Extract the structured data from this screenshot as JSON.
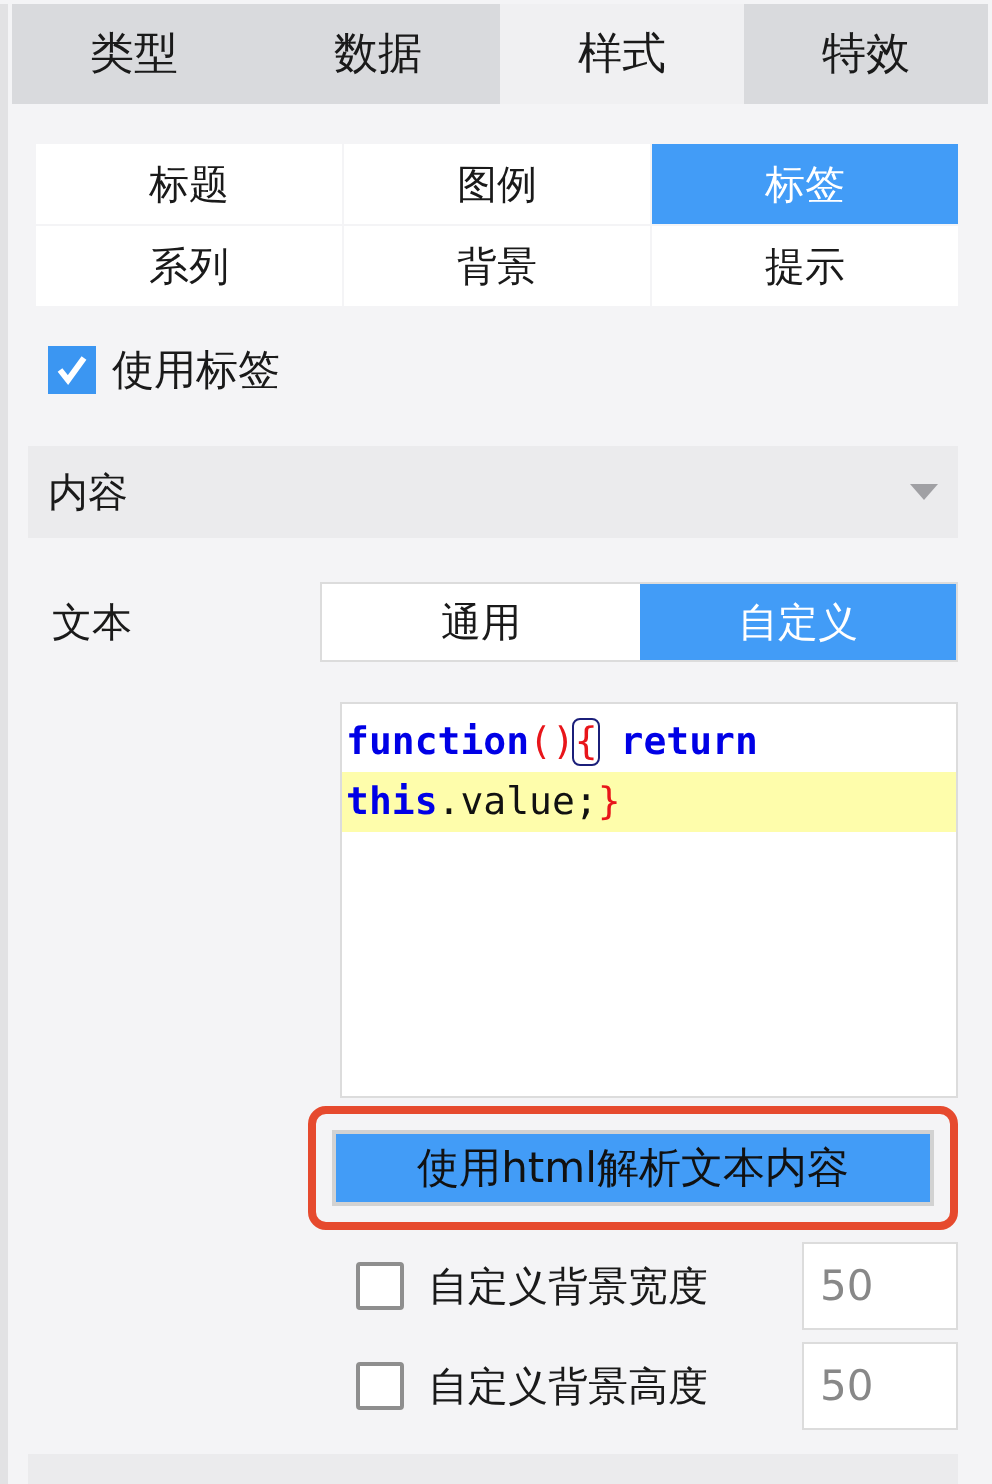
{
  "main_tabs": [
    {
      "label": "类型",
      "selected": false
    },
    {
      "label": "数据",
      "selected": false
    },
    {
      "label": "样式",
      "selected": true
    },
    {
      "label": "特效",
      "selected": false
    }
  ],
  "style_tabs": [
    {
      "label": "标题",
      "selected": false
    },
    {
      "label": "图例",
      "selected": false
    },
    {
      "label": "标签",
      "selected": true
    },
    {
      "label": "系列",
      "selected": false
    },
    {
      "label": "背景",
      "selected": false
    },
    {
      "label": "提示",
      "selected": false
    }
  ],
  "use_label": {
    "label": "使用标签",
    "checked": true
  },
  "section": {
    "title": "内容",
    "expanded": true
  },
  "text_field": {
    "label": "文本",
    "options": [
      {
        "label": "通用",
        "selected": false
      },
      {
        "label": "自定义",
        "selected": true
      }
    ]
  },
  "code_editor": {
    "lines": [
      {
        "current": false,
        "tokens": [
          {
            "text": "function",
            "kind": "keyword"
          },
          {
            "text": "()",
            "kind": "bracket"
          },
          {
            "text": "{",
            "kind": "matched-bracket"
          },
          {
            "text": "return",
            "kind": "keyword",
            "space_before": true
          }
        ]
      },
      {
        "current": true,
        "tokens": [
          {
            "text": "this",
            "kind": "keyword"
          },
          {
            "text": ".value;",
            "kind": "plain"
          },
          {
            "text": "}",
            "kind": "bracket"
          }
        ]
      }
    ]
  },
  "html_button": {
    "label": "使用html解析文本内容",
    "highlighted": true
  },
  "options": [
    {
      "label": "自定义背景宽度",
      "checked": false,
      "value": "50"
    },
    {
      "label": "自定义背景高度",
      "checked": false,
      "value": "50"
    }
  ]
}
